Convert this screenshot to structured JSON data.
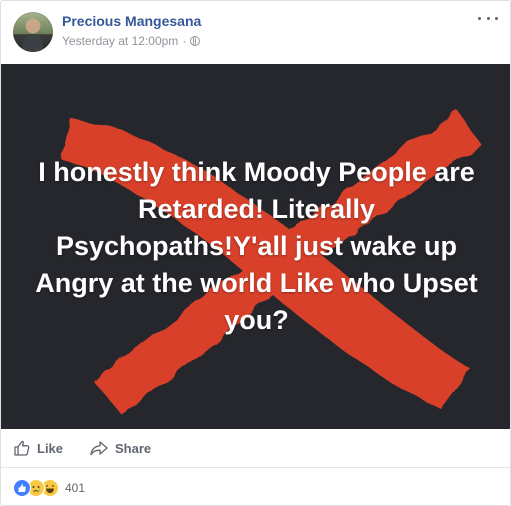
{
  "post": {
    "author_name": "Precious Mangesana",
    "timestamp": "Yesterday at 12:00pm",
    "separator": "·",
    "privacy_icon": "globe-icon",
    "more_icon": "more-options-icon",
    "image": {
      "caption": "I honestly think Moody People are Retarded! Literally Psychopaths!Y'all just wake up Angry at the world Like who Upset you?",
      "background_color": "#25272c",
      "x_mark_color": "#d9402a"
    }
  },
  "actions": {
    "like_label": "Like",
    "share_label": "Share"
  },
  "reactions": {
    "types": [
      "like-icon",
      "sad-icon",
      "haha-icon"
    ],
    "count": "401"
  }
}
